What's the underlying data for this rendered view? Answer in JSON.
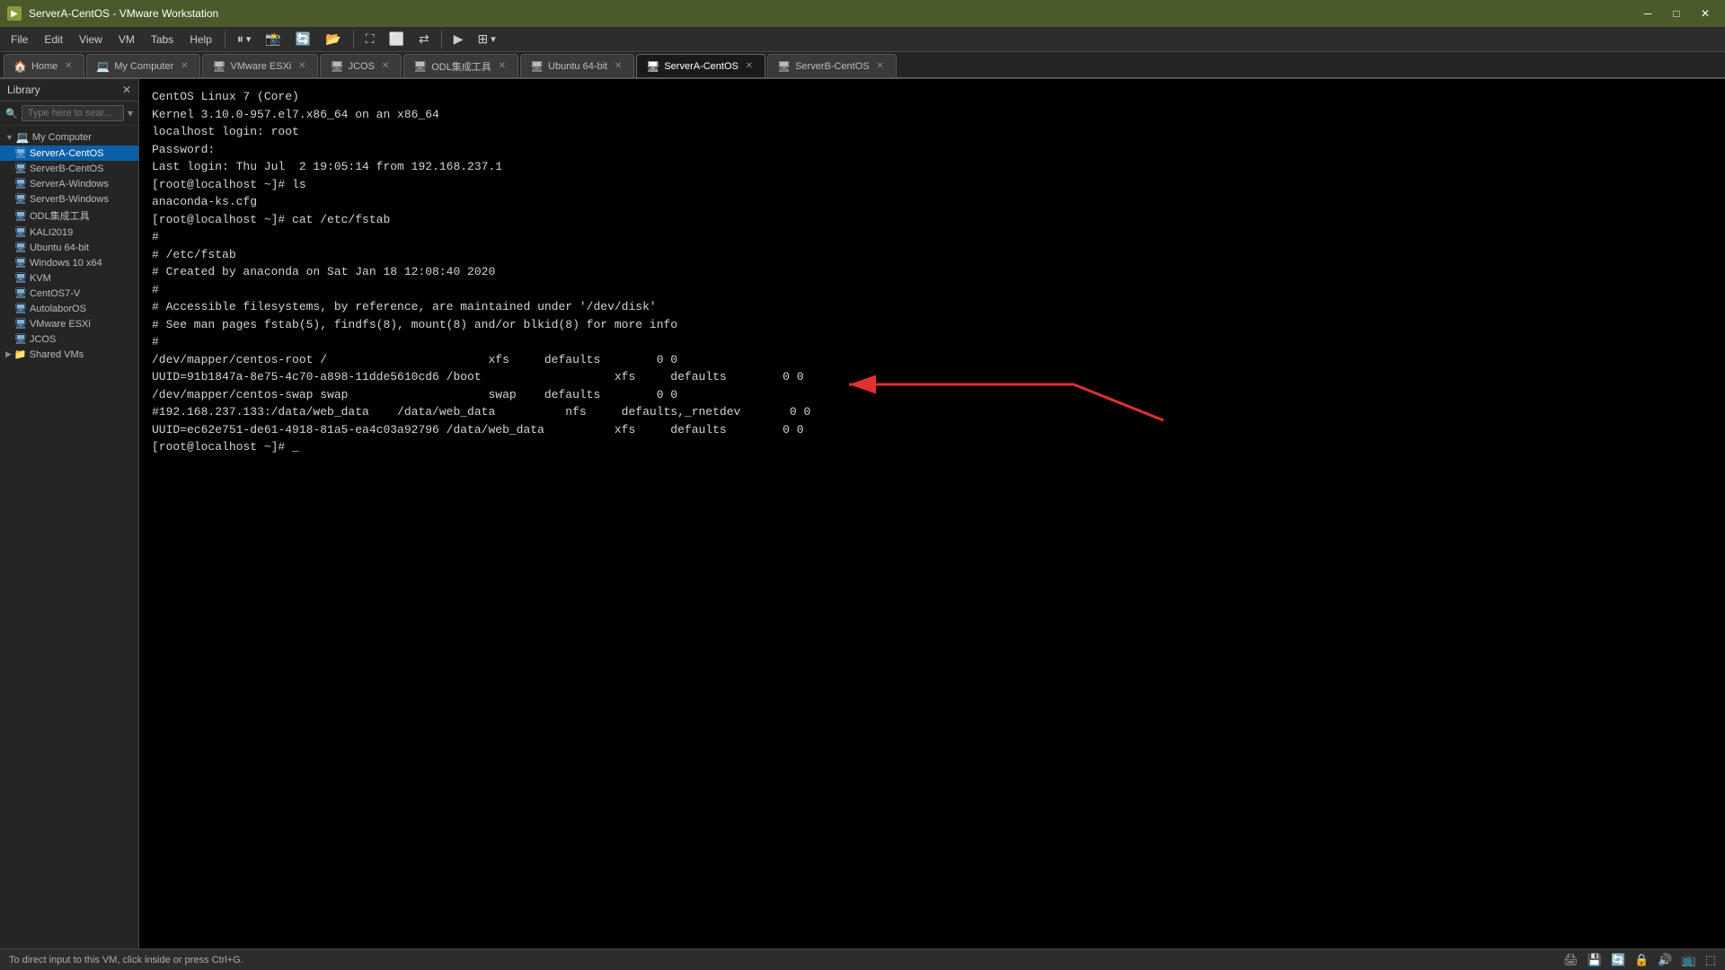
{
  "titleBar": {
    "title": "ServerA-CentOS - VMware Workstation",
    "icon": "▶"
  },
  "menuBar": {
    "items": [
      "File",
      "Edit",
      "View",
      "VM",
      "Tabs",
      "Help"
    ],
    "toolbarButtons": [
      "⏸",
      "⏹",
      "⏺",
      "↩",
      "⬆",
      "⬛",
      "⬜",
      "⛶",
      "⟳",
      "⇄",
      "▶",
      "⊞"
    ]
  },
  "tabs": [
    {
      "label": "Home",
      "icon": "🏠",
      "active": false,
      "closeable": true
    },
    {
      "label": "My Computer",
      "icon": "💻",
      "active": false,
      "closeable": true
    },
    {
      "label": "VMware ESXi",
      "icon": "🖥",
      "active": false,
      "closeable": true
    },
    {
      "label": "JCOS",
      "icon": "🖥",
      "active": false,
      "closeable": true
    },
    {
      "label": "ODL集成工具",
      "icon": "🖥",
      "active": false,
      "closeable": true
    },
    {
      "label": "Ubuntu 64-bit",
      "icon": "🖥",
      "active": false,
      "closeable": true
    },
    {
      "label": "ServerA-CentOS",
      "icon": "🖥",
      "active": true,
      "closeable": true
    },
    {
      "label": "ServerB-CentOS",
      "icon": "🖥",
      "active": false,
      "closeable": true
    }
  ],
  "library": {
    "header": "Library",
    "searchPlaceholder": "Type here to sear...",
    "tree": [
      {
        "label": "My Computer",
        "type": "group",
        "indent": 0,
        "expanded": true
      },
      {
        "label": "ServerA-CentOS",
        "type": "vm",
        "indent": 1,
        "selected": true
      },
      {
        "label": "ServerB-CentOS",
        "type": "vm",
        "indent": 1
      },
      {
        "label": "ServerA-Windows",
        "type": "vm-win",
        "indent": 1
      },
      {
        "label": "ServerB-Windows",
        "type": "vm-win",
        "indent": 1
      },
      {
        "label": "ODL集成工具",
        "type": "vm",
        "indent": 1
      },
      {
        "label": "KALI2019",
        "type": "vm",
        "indent": 1
      },
      {
        "label": "Ubuntu 64-bit",
        "type": "vm",
        "indent": 1
      },
      {
        "label": "Windows 10 x64",
        "type": "vm-win",
        "indent": 1
      },
      {
        "label": "KVM",
        "type": "vm",
        "indent": 1
      },
      {
        "label": "CentOS7-V",
        "type": "vm",
        "indent": 1
      },
      {
        "label": "AutolaborOS",
        "type": "vm",
        "indent": 1
      },
      {
        "label": "VMware ESXi",
        "type": "vm",
        "indent": 1
      },
      {
        "label": "JCOS",
        "type": "vm",
        "indent": 1
      },
      {
        "label": "Shared VMs",
        "type": "shared",
        "indent": 0
      }
    ]
  },
  "terminal": {
    "lines": [
      "",
      "CentOS Linux 7 (Core)",
      "Kernel 3.10.0-957.el7.x86_64 on an x86_64",
      "",
      "localhost login: root",
      "Password:",
      "Last login: Thu Jul  2 19:05:14 from 192.168.237.1",
      "[root@localhost ~]# ls",
      "anaconda-ks.cfg",
      "[root@localhost ~]# cat /etc/fstab",
      "",
      "#",
      "# /etc/fstab",
      "# Created by anaconda on Sat Jan 18 12:08:40 2020",
      "#",
      "# Accessible filesystems, by reference, are maintained under '/dev/disk'",
      "# See man pages fstab(5), findfs(8), mount(8) and/or blkid(8) for more info",
      "#",
      "/dev/mapper/centos-root /                       xfs     defaults        0 0",
      "UUID=91b1847a-8e75-4c70-a898-11dde5610cd6 /boot                   xfs     defaults        0 0",
      "/dev/mapper/centos-swap swap                    swap    defaults        0 0",
      "#192.168.237.133:/data/web_data    /data/web_data          nfs     defaults,_rnetdev       0 0",
      "UUID=ec62e751-de61-4918-81a5-ea4c03a92796 /data/web_data          xfs     defaults        0 0",
      "[root@localhost ~]# _"
    ]
  },
  "statusBar": {
    "hint": "To direct input to this VM, click inside or press Ctrl+G.",
    "icons": [
      "🖨",
      "💾",
      "🔄",
      "🔒",
      "🔊",
      "📺",
      "⬚"
    ]
  }
}
